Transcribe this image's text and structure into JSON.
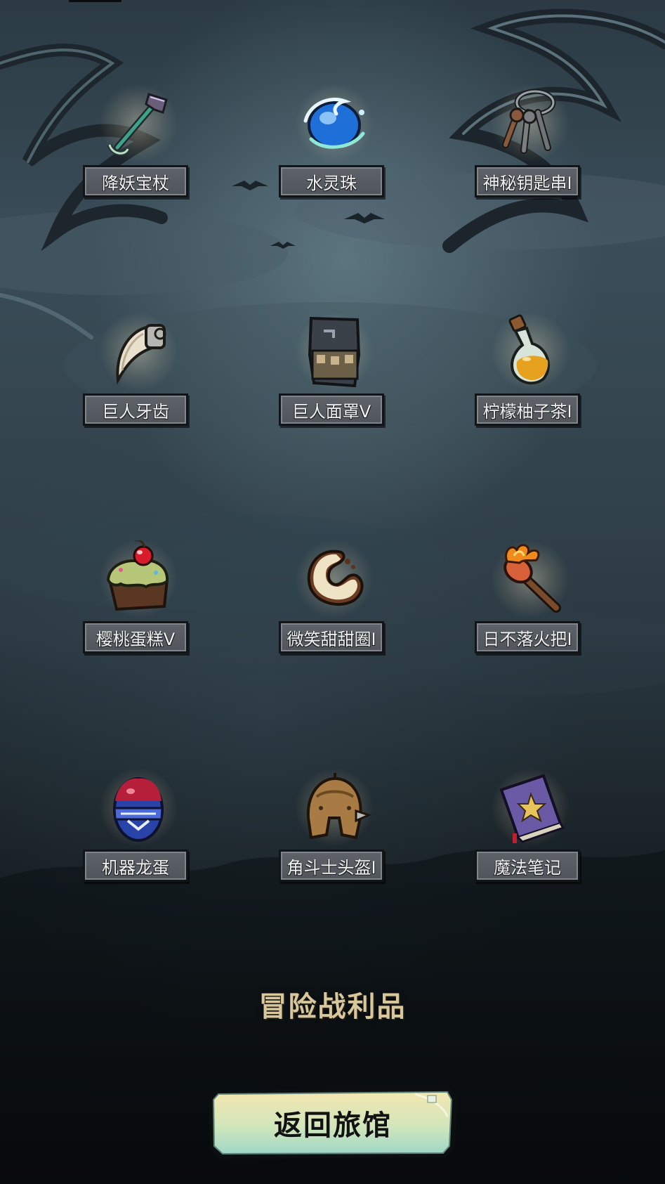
{
  "items": [
    {
      "name": "降妖宝杖",
      "icon": "staff-icon"
    },
    {
      "name": "水灵珠",
      "icon": "water-orb-icon"
    },
    {
      "name": "神秘钥匙串I",
      "icon": "keyring-icon"
    },
    {
      "name": "巨人牙齿",
      "icon": "fang-icon"
    },
    {
      "name": "巨人面罩V",
      "icon": "mask-icon"
    },
    {
      "name": "柠檬柚子茶I",
      "icon": "potion-icon"
    },
    {
      "name": "樱桃蛋糕V",
      "icon": "cake-icon"
    },
    {
      "name": "微笑甜甜圈I",
      "icon": "donut-icon"
    },
    {
      "name": "日不落火把I",
      "icon": "torch-icon"
    },
    {
      "name": "机器龙蛋",
      "icon": "egg-icon"
    },
    {
      "name": "角斗士头盔I",
      "icon": "helmet-icon"
    },
    {
      "name": "魔法笔记",
      "icon": "spellbook-icon"
    }
  ],
  "section_title": "冒险战利品",
  "return_button": {
    "label": "返回旅馆"
  },
  "colors": {
    "title": "#d8c79b",
    "plate": "#54595f",
    "button_top": "#f3e7b0",
    "button_bottom": "#9fd7c8"
  }
}
